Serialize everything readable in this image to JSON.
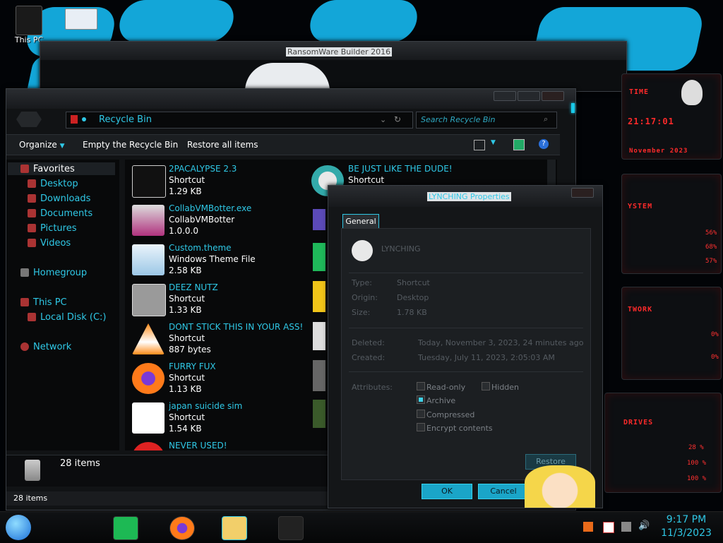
{
  "desktop": {
    "icons": [
      {
        "label": "This PC"
      },
      {
        "label": ""
      }
    ]
  },
  "background_window": {
    "title": "RansomWare Builder 2016"
  },
  "explorer": {
    "address": "Recycle Bin",
    "search_placeholder": "Search Recycle Bin",
    "commands": {
      "organize": "Organize",
      "empty": "Empty the Recycle Bin",
      "restore_all": "Restore all items"
    },
    "nav": {
      "favorites": "Favorites",
      "desktop": "Desktop",
      "downloads": "Downloads",
      "documents": "Documents",
      "pictures": "Pictures",
      "videos": "Videos",
      "homegroup": "Homegroup",
      "thispc": "This PC",
      "localdisk": "Local Disk (C:)",
      "network": "Network"
    },
    "items": [
      {
        "name": "2PACALYPSE 2.3",
        "type": "Shortcut",
        "size": "1.29 KB",
        "icon": "console-icon"
      },
      {
        "name": "CollabVMBotter.exe",
        "type": "CollabVMBotter",
        "size": "1.0.0.0",
        "icon": "app-icon"
      },
      {
        "name": "Custom.theme",
        "type": "Windows Theme File",
        "size": "2.58 KB",
        "icon": "theme-icon"
      },
      {
        "name": "DEEZ NUTZ",
        "type": "Shortcut",
        "size": "1.33 KB",
        "icon": "windows-stack-icon"
      },
      {
        "name": "DONT STICK THIS IN YOUR ASS!",
        "type": "Shortcut",
        "size": "887 bytes",
        "icon": "vlc-icon"
      },
      {
        "name": "FURRY FUX",
        "type": "Shortcut",
        "size": "1.13 KB",
        "icon": "firefox-icon"
      },
      {
        "name": "japan suicide sim",
        "type": "Shortcut",
        "size": "1.54 KB",
        "icon": "shortcut-icon"
      },
      {
        "name": "NEVER USED!",
        "type": "",
        "size": "",
        "icon": "red-icon"
      }
    ],
    "items_col2": [
      {
        "name": "BE JUST LIKE THE DUDE!",
        "type": "Shortcut",
        "size": ""
      }
    ],
    "details_count": "28 items",
    "status_count": "28 items"
  },
  "properties": {
    "title": "LYNCHING Properties",
    "tab": "General",
    "filename": "LYNCHING",
    "type_label": "Type:",
    "type_value": "Shortcut",
    "origin_label": "Origin:",
    "origin_value": "Desktop",
    "size_label": "Size:",
    "size_value": "1.78 KB",
    "deleted_label": "Deleted:",
    "deleted_value": "Today, November 3, 2023, 24 minutes ago",
    "created_label": "Created:",
    "created_value": "Tuesday, July 11, 2023, 2:05:03 AM",
    "attributes_label": "Attributes:",
    "attrs": {
      "readonly": "Read-only",
      "hidden": "Hidden",
      "archive": "Archive",
      "compressed": "Compressed",
      "encrypt": "Encrypt contents"
    },
    "attr_state": {
      "readonly": false,
      "hidden": false,
      "archive": true,
      "compressed": false,
      "encrypt": false
    },
    "restore": "Restore",
    "ok": "OK",
    "cancel": "Cancel"
  },
  "gadget": {
    "time_label": "TIME",
    "time_value": "21:17:01",
    "date_value": "November 2023",
    "system_label": "YSTEM",
    "cpu": "56%",
    "mem": "68%",
    "disk": "57%",
    "network_label": "TWORK",
    "net1": "0%",
    "net2": "0%",
    "drives_label": "DRIVES",
    "d1": "28 %",
    "d2": "100 %",
    "d3": "100 %"
  },
  "taskbar": {
    "time": "9:17 PM",
    "date": "11/3/2023"
  },
  "colors": {
    "accent": "#2fc8e6",
    "gadget_red": "#ff2a2a",
    "window_bg": "#151719"
  }
}
